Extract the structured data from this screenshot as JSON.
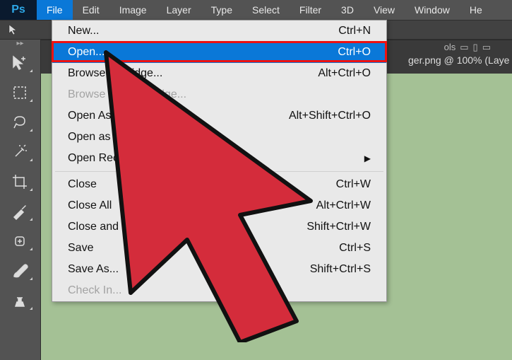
{
  "menubar": {
    "items": [
      "File",
      "Edit",
      "Image",
      "Layer",
      "Type",
      "Select",
      "Filter",
      "3D",
      "View",
      "Window",
      "He"
    ],
    "active_index": 0
  },
  "toolbar": {
    "right_labels": "ols"
  },
  "document": {
    "tab_label": "ger.png @ 100% (Laye"
  },
  "dropdown": {
    "items": [
      {
        "label": "New...",
        "shortcut": "Ctrl+N",
        "submenu": false,
        "disabled": false
      },
      {
        "label": "Open...",
        "shortcut": "Ctrl+O",
        "submenu": false,
        "disabled": false,
        "highlighted": true
      },
      {
        "label": "Browse in Bridge...",
        "shortcut": "Alt+Ctrl+O",
        "submenu": false,
        "disabled": false
      },
      {
        "label": "Browse in Mini Bridge...",
        "shortcut": "",
        "submenu": false,
        "disabled": true
      },
      {
        "label": "Open As...",
        "shortcut": "Alt+Shift+Ctrl+O",
        "submenu": false,
        "disabled": false
      },
      {
        "label": "Open as Smart Object...",
        "shortcut": "",
        "submenu": false,
        "disabled": false
      },
      {
        "label": "Open Recent",
        "shortcut": "",
        "submenu": true,
        "disabled": false
      },
      {
        "sep": true
      },
      {
        "label": "Close",
        "shortcut": "Ctrl+W",
        "submenu": false,
        "disabled": false
      },
      {
        "label": "Close All",
        "shortcut": "Alt+Ctrl+W",
        "submenu": false,
        "disabled": false
      },
      {
        "label": "Close and Go to Bridge...",
        "shortcut": "Shift+Ctrl+W",
        "submenu": false,
        "disabled": false
      },
      {
        "label": "Save",
        "shortcut": "Ctrl+S",
        "submenu": false,
        "disabled": false
      },
      {
        "label": "Save As...",
        "shortcut": "Shift+Ctrl+S",
        "submenu": false,
        "disabled": false
      },
      {
        "label": "Check In...",
        "shortcut": "",
        "submenu": false,
        "disabled": true
      }
    ]
  },
  "annotation": {
    "highlight_color": "#e11",
    "arrow_fill": "#d42c3b",
    "arrow_stroke": "#111"
  }
}
